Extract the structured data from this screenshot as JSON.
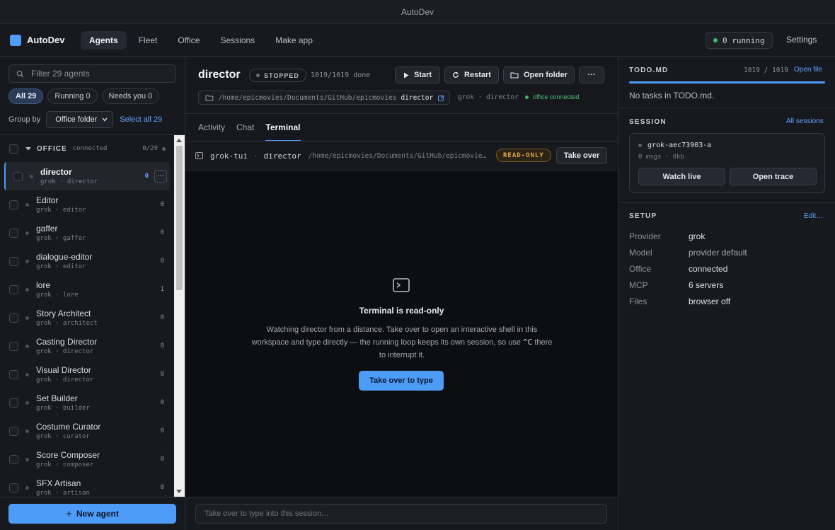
{
  "window": {
    "title": "AutoDev"
  },
  "nav": {
    "brand": "AutoDev",
    "tabs": [
      {
        "label": "Agents",
        "active": true
      },
      {
        "label": "Fleet"
      },
      {
        "label": "Office"
      },
      {
        "label": "Sessions"
      },
      {
        "label": "Make app"
      }
    ],
    "running": "0 running",
    "settings": "Settings"
  },
  "sidebar": {
    "filter_placeholder": "Filter 29 agents",
    "chips": [
      {
        "label": "All 29",
        "active": true
      },
      {
        "label": "Running 0"
      },
      {
        "label": "Needs you 0"
      }
    ],
    "group_by_label": "Group by",
    "group_by_value": "Office folder",
    "select_all": "Select all 29",
    "group": {
      "name": "OFFICE",
      "status": "connected",
      "count": "0/29"
    },
    "agents": [
      {
        "name": "director",
        "sub": "grok · director",
        "count": "0",
        "selected": true
      },
      {
        "name": "Editor",
        "sub": "grok · editor",
        "count": "0"
      },
      {
        "name": "gaffer",
        "sub": "grok · gaffer",
        "count": "0"
      },
      {
        "name": "dialogue-editor",
        "sub": "grok · editor",
        "count": "0"
      },
      {
        "name": "lore",
        "sub": "grok · lore",
        "count": "1"
      },
      {
        "name": "Story Architect",
        "sub": "grok · architect",
        "count": "0"
      },
      {
        "name": "Casting Director",
        "sub": "grok · director",
        "count": "0"
      },
      {
        "name": "Visual Director",
        "sub": "grok · director",
        "count": "0"
      },
      {
        "name": "Set Builder",
        "sub": "grok · builder",
        "count": "0"
      },
      {
        "name": "Costume Curator",
        "sub": "grok · curator",
        "count": "0"
      },
      {
        "name": "Score Composer",
        "sub": "grok · composer",
        "count": "0"
      },
      {
        "name": "SFX Artisan",
        "sub": "grok · artisan",
        "count": "0"
      }
    ],
    "more_glyph": "···",
    "new_agent": "New agent"
  },
  "main": {
    "agent_name": "director",
    "status": "STOPPED",
    "done": "1019/1019 done",
    "buttons": {
      "start": "Start",
      "restart": "Restart",
      "open_folder": "Open folder",
      "more": "···"
    },
    "path": "/home/epicmovies/Documents/GitHub/epicmovies",
    "path_leaf": "director",
    "meta": "grok · director",
    "office": "office connected",
    "tabs": [
      {
        "label": "Activity"
      },
      {
        "label": "Chat"
      },
      {
        "label": "Terminal",
        "active": true
      }
    ],
    "terminal": {
      "tui": "grok-tui",
      "agent": "director",
      "sep": "·",
      "path": "/home/epicmovies/Documents/GitHub/epicmovies/director",
      "badge": "READ-ONLY",
      "take_over": "Take over",
      "title": "Terminal is read-only",
      "desc_1": "Watching director from a distance. Take over to open an interactive shell in this workspace and type directly — the running loop keeps its own session, so use",
      "desc_key": "^C",
      "desc_2": "there to interrupt it.",
      "cta": "Take over to type"
    },
    "input_placeholder": "Take over to type into this session…"
  },
  "right": {
    "todo": {
      "title": "TODO.MD",
      "count": "1019 / 1019",
      "open": "Open file",
      "progress": 1.0,
      "empty": "No tasks in TODO.md."
    },
    "session": {
      "title": "SESSION",
      "all": "All sessions",
      "id": "grok-aec73903-a",
      "meta": "0 msgs · 0kb",
      "watch": "Watch live",
      "trace": "Open trace"
    },
    "setup": {
      "title": "SETUP",
      "edit": "Edit…",
      "rows": [
        {
          "key": "Provider",
          "value": "grok"
        },
        {
          "key": "Model",
          "value": "provider default"
        },
        {
          "key": "Office",
          "value": "connected"
        },
        {
          "key": "MCP",
          "value": "6 servers"
        },
        {
          "key": "Files",
          "value": "browser off"
        }
      ]
    }
  },
  "colors": {
    "accent": "#4d9cf8",
    "success": "#3fb96b",
    "warning": "#e3a848",
    "background": "#16181d"
  },
  "icons": [
    "search-icon",
    "chevron-down-icon",
    "play-icon",
    "restart-icon",
    "folder-icon",
    "external-link-icon",
    "terminal-icon",
    "plus-icon"
  ]
}
